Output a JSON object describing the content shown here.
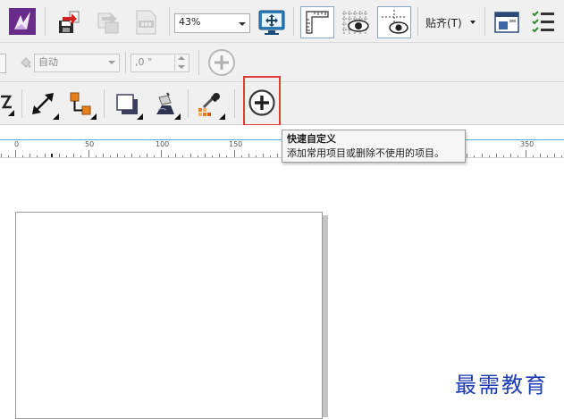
{
  "toolbar": {
    "zoom_value": "43%",
    "snap_label": "贴齐(T)"
  },
  "property_bar": {
    "fill_mode_value": "自动",
    "angle_value": ",0 °"
  },
  "ruler": {
    "labels": [
      "0",
      "50",
      "100",
      "150",
      "350"
    ]
  },
  "tooltip": {
    "title": "快速自定义",
    "description": "添加常用项目或删除不使用的项目。"
  },
  "watermark": {
    "text": "最需教育"
  },
  "colors": {
    "accent_purple": "#6a2c8a",
    "highlight_red": "#e03a3a",
    "ruler_line": "#47b4d6",
    "watermark_blue": "#1d3bb3"
  }
}
